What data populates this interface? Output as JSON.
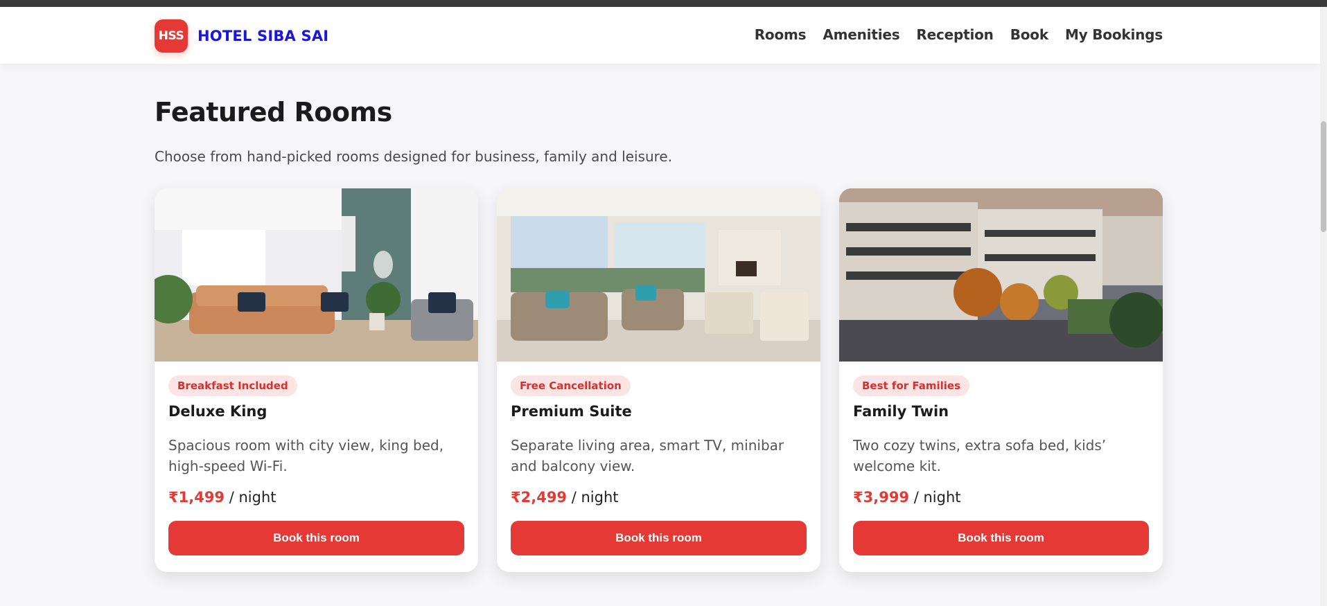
{
  "brand": {
    "logo_text": "HSS",
    "name": "HOTEL SIBA SAI"
  },
  "nav": [
    {
      "label": "Rooms"
    },
    {
      "label": "Amenities"
    },
    {
      "label": "Reception"
    },
    {
      "label": "Book"
    },
    {
      "label": "My Bookings"
    }
  ],
  "section": {
    "title": "Featured Rooms",
    "subtitle": "Choose from hand-picked rooms designed for business, family and leisure."
  },
  "rooms": [
    {
      "badge": "Breakfast Included",
      "name": "Deluxe King",
      "description": "Spacious room with city view, king bed, high-speed Wi-Fi.",
      "price": "₹1,499",
      "unit": "/ night",
      "button": "Book this room"
    },
    {
      "badge": "Free Cancellation",
      "name": "Premium Suite",
      "description": "Separate living area, smart TV, minibar and balcony view.",
      "price": "₹2,499",
      "unit": "/ night",
      "button": "Book this room"
    },
    {
      "badge": "Best for Families",
      "name": "Family Twin",
      "description": "Two cozy twins, extra sofa bed, kids’ welcome kit.",
      "price": "₹3,999",
      "unit": "/ night",
      "button": "Book this room"
    }
  ],
  "colors": {
    "accent": "#e53935",
    "brand_text": "#1a14e0",
    "badge_bg": "#fde4e4",
    "page_bg": "#f6f6f8"
  }
}
